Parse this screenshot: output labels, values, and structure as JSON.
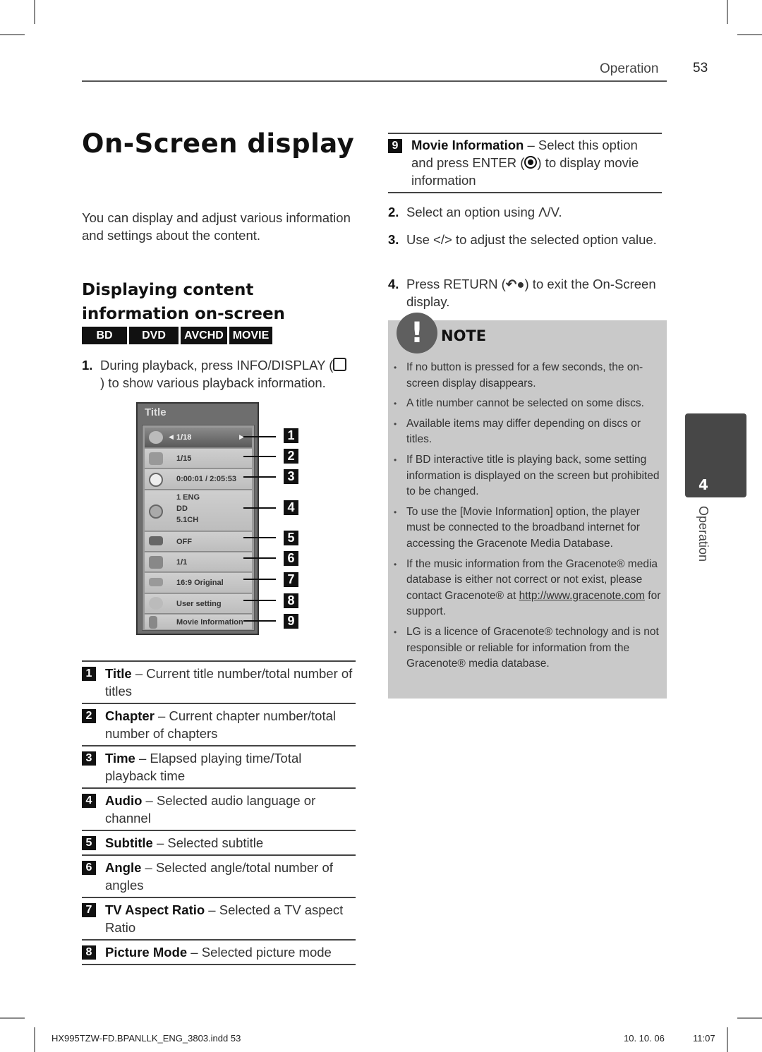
{
  "header": {
    "section": "Operation",
    "page_number": "53"
  },
  "title": "On-Screen display",
  "intro": "You can display and adjust various information and settings about the content.",
  "subheading": "Displaying content information on-screen",
  "media_badges": [
    "BD",
    "DVD",
    "AVCHD",
    "MOVIE"
  ],
  "steps": [
    {
      "num": "1.",
      "text_before": "During playback, press INFO/DISPLAY (",
      "icon": "display-icon",
      "text_after": ") to show various playback information."
    },
    {
      "num": "2.",
      "text": "Select an option using Λ/V."
    },
    {
      "num": "3.",
      "text": "Use </> to adjust the selected option value."
    },
    {
      "num": "4.",
      "text_before": "Press RETURN (",
      "icon": "return-icon",
      "text_after": ") to exit the On-Screen display."
    }
  ],
  "osd_menu": {
    "title": "Title",
    "rows": [
      {
        "callout": "1",
        "icon": "disc-icon",
        "value": "1/18",
        "selected": true
      },
      {
        "callout": "2",
        "icon": "clapperboard-icon",
        "value": "1/15"
      },
      {
        "callout": "3",
        "icon": "clock-icon",
        "value": "0:00:01 / 2:05:53"
      },
      {
        "callout": "4",
        "icon": "speaker-icon",
        "value_lines": [
          "1 ENG",
          "DD",
          "5.1CH"
        ]
      },
      {
        "callout": "5",
        "icon": "subtitle-icon",
        "value": "OFF"
      },
      {
        "callout": "6",
        "icon": "camera-angle-icon",
        "value": "1/1"
      },
      {
        "callout": "7",
        "icon": "aspect-ratio-icon",
        "value": "16:9 Original"
      },
      {
        "callout": "8",
        "icon": "palette-icon",
        "value": "User setting"
      },
      {
        "callout": "9",
        "icon": "movie-info-icon",
        "value": "Movie Information"
      }
    ]
  },
  "definitions": [
    {
      "num": "1",
      "term": "Title",
      "desc": " – Current title number/total number of titles"
    },
    {
      "num": "2",
      "term": "Chapter",
      "desc": " – Current chapter number/total number of chapters"
    },
    {
      "num": "3",
      "term": "Time",
      "desc": " – Elapsed playing time/Total playback time"
    },
    {
      "num": "4",
      "term": "Audio",
      "desc": " – Selected audio language or channel"
    },
    {
      "num": "5",
      "term": "Subtitle",
      "desc": " – Selected subtitle"
    },
    {
      "num": "6",
      "term": "Angle",
      "desc": " – Selected angle/total number of angles"
    },
    {
      "num": "7",
      "term": "TV Aspect Ratio",
      "desc": " – Selected a TV aspect Ratio"
    },
    {
      "num": "8",
      "term": "Picture Mode",
      "desc": " – Selected picture mode"
    },
    {
      "num": "9",
      "term": "Movie Information",
      "desc_before": " – Select this option and press ENTER (",
      "icon": "enter-icon",
      "desc_after": ") to display movie information"
    }
  ],
  "note": {
    "title": "NOTE",
    "items": [
      "If no button is pressed for a few seconds, the on-screen display disappears.",
      "A title number cannot be selected on some discs.",
      "Available items may differ depending on discs or titles.",
      "If BD interactive title is playing back, some setting information is displayed on the screen but prohibited to be changed.",
      "To use the [Movie Information] option, the player must be connected to the broadband internet for accessing the Gracenote Media Database."
    ],
    "item_gracenote": {
      "before": "If the music information from the Gracenote® media database is either not correct or not exist, please contact Gracenote® at ",
      "link": "http://www.gracenote.com",
      "after": " for support."
    },
    "item_last": "LG is a licence of Gracenote® technology and is not responsible or reliable for information from the Gracenote® media database."
  },
  "chapter_tab": {
    "number": "4",
    "label": "Operation"
  },
  "footer": {
    "file": "HX995TZW-FD.BPANLLK_ENG_3803.indd   53",
    "date": "10. 10. 06",
    "time": "11:07"
  },
  "colors": {
    "note_background": "#c9c9c9",
    "chapter_tab": "#474747",
    "badge": "#111111"
  }
}
